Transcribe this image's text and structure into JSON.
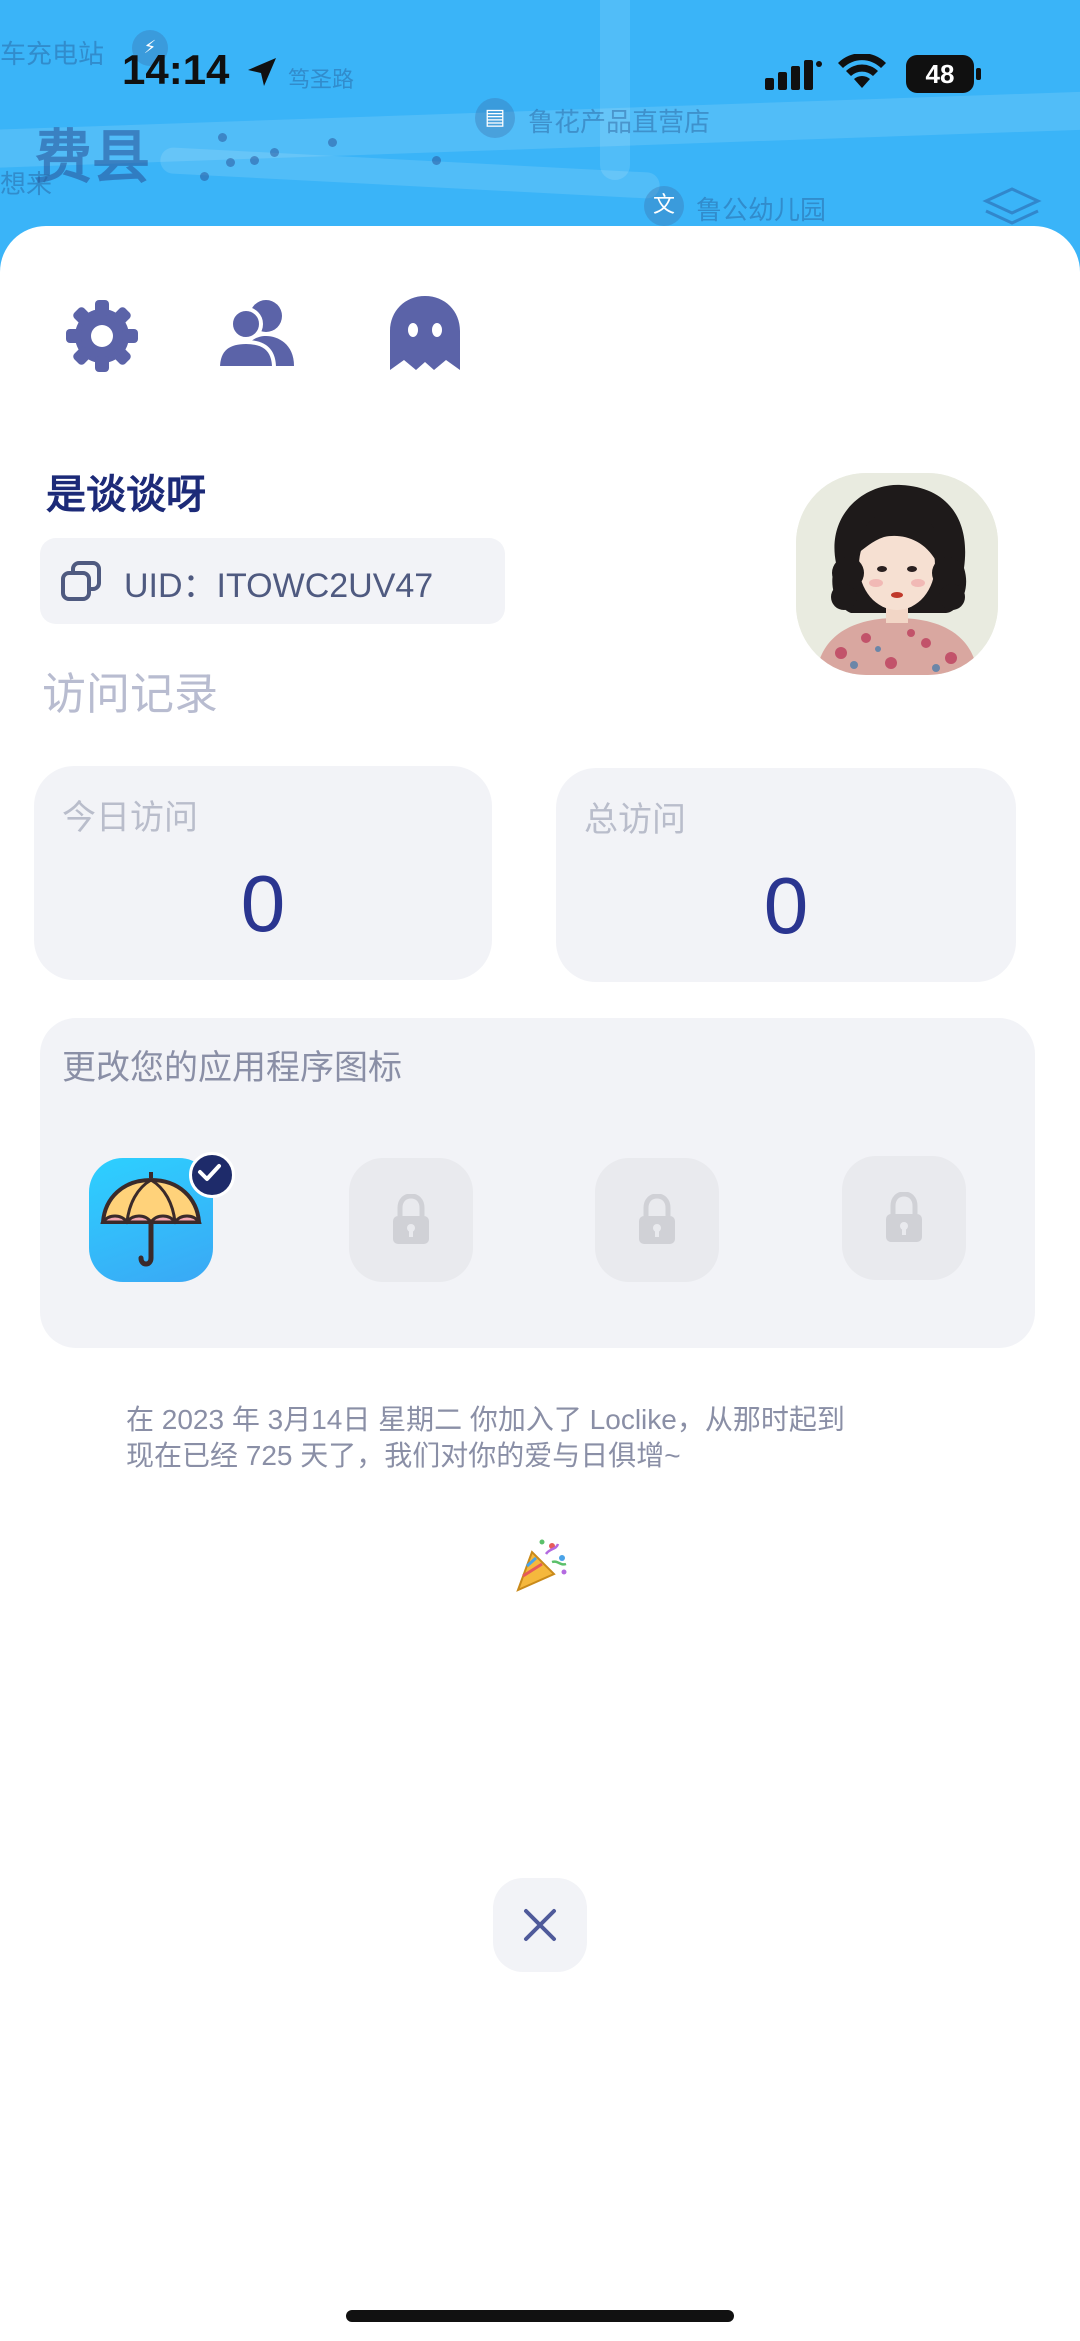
{
  "status_bar": {
    "time": "14:14",
    "battery_level": "48"
  },
  "map": {
    "labels": {
      "charging_station": "车充电站",
      "road": "笃圣路",
      "county": "费县",
      "store": "鲁花产品直营店",
      "kindergarten": "鲁公幼儿园",
      "partial_label": "想来"
    }
  },
  "toolbar": {
    "icons": [
      "settings-icon",
      "friends-icon",
      "ghost-icon"
    ],
    "icon_color": "#5b63a8"
  },
  "profile": {
    "username": "是谈谈呀",
    "uid_text": "UID：ITOWC2UV47"
  },
  "visits": {
    "section_title": "访问记录",
    "today_label": "今日访问",
    "today_value": "0",
    "total_label": "总访问",
    "total_value": "0"
  },
  "app_icon_picker": {
    "title": "更改您的应用程序图标",
    "options": [
      {
        "icon": "umbrella-icon",
        "state": "selected"
      },
      {
        "icon": "lock-icon",
        "state": "locked"
      },
      {
        "icon": "lock-icon",
        "state": "locked"
      },
      {
        "icon": "lock-icon",
        "state": "locked"
      }
    ]
  },
  "join_message": {
    "line1": "在 2023 年 3月14日 星期二 你加入了 Loclike，从那时起到",
    "line2": "现在已经 725 天了，我们对你的爱与日俱增~"
  },
  "colors": {
    "map_blue": "#3ab4f8",
    "accent": "#1c2a78",
    "card_bg": "#f2f3f7"
  }
}
